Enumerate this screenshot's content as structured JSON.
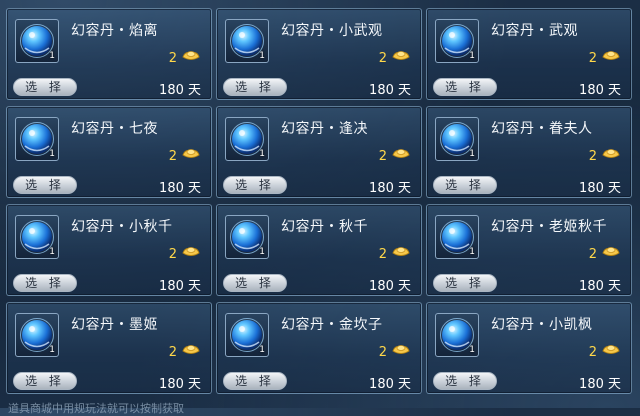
{
  "items": [
    {
      "name": "幻容丹・焰离",
      "price": "2",
      "qty": "1",
      "duration": "180 天",
      "button": "选 择"
    },
    {
      "name": "幻容丹・小武观",
      "price": "2",
      "qty": "1",
      "duration": "180 天",
      "button": "选 择"
    },
    {
      "name": "幻容丹・武观",
      "price": "2",
      "qty": "1",
      "duration": "180 天",
      "button": "选 择"
    },
    {
      "name": "幻容丹・七夜",
      "price": "2",
      "qty": "1",
      "duration": "180 天",
      "button": "选 择"
    },
    {
      "name": "幻容丹・逢决",
      "price": "2",
      "qty": "1",
      "duration": "180 天",
      "button": "选 择"
    },
    {
      "name": "幻容丹・眷夫人",
      "price": "2",
      "qty": "1",
      "duration": "180 天",
      "button": "选 择"
    },
    {
      "name": "幻容丹・小秋千",
      "price": "2",
      "qty": "1",
      "duration": "180 天",
      "button": "选 择"
    },
    {
      "name": "幻容丹・秋千",
      "price": "2",
      "qty": "1",
      "duration": "180 天",
      "button": "选 择"
    },
    {
      "name": "幻容丹・老姬秋千",
      "price": "2",
      "qty": "1",
      "duration": "180 天",
      "button": "选 择"
    },
    {
      "name": "幻容丹・墨姬",
      "price": "2",
      "qty": "1",
      "duration": "180 天",
      "button": "选 择"
    },
    {
      "name": "幻容丹・金坎子",
      "price": "2",
      "qty": "1",
      "duration": "180 天",
      "button": "选 择"
    },
    {
      "name": "幻容丹・小凯枫",
      "price": "2",
      "qty": "1",
      "duration": "180 天",
      "button": "选 择"
    }
  ],
  "icons": {
    "item": "blue-orb-icon",
    "currency": "gold-ingot-icon"
  },
  "colors": {
    "price": "#ffd84a",
    "text": "#f4f7fa",
    "accent": "#4fb3ff"
  },
  "footer": {
    "text": "道具商城中用规玩法就可以按制获取"
  }
}
